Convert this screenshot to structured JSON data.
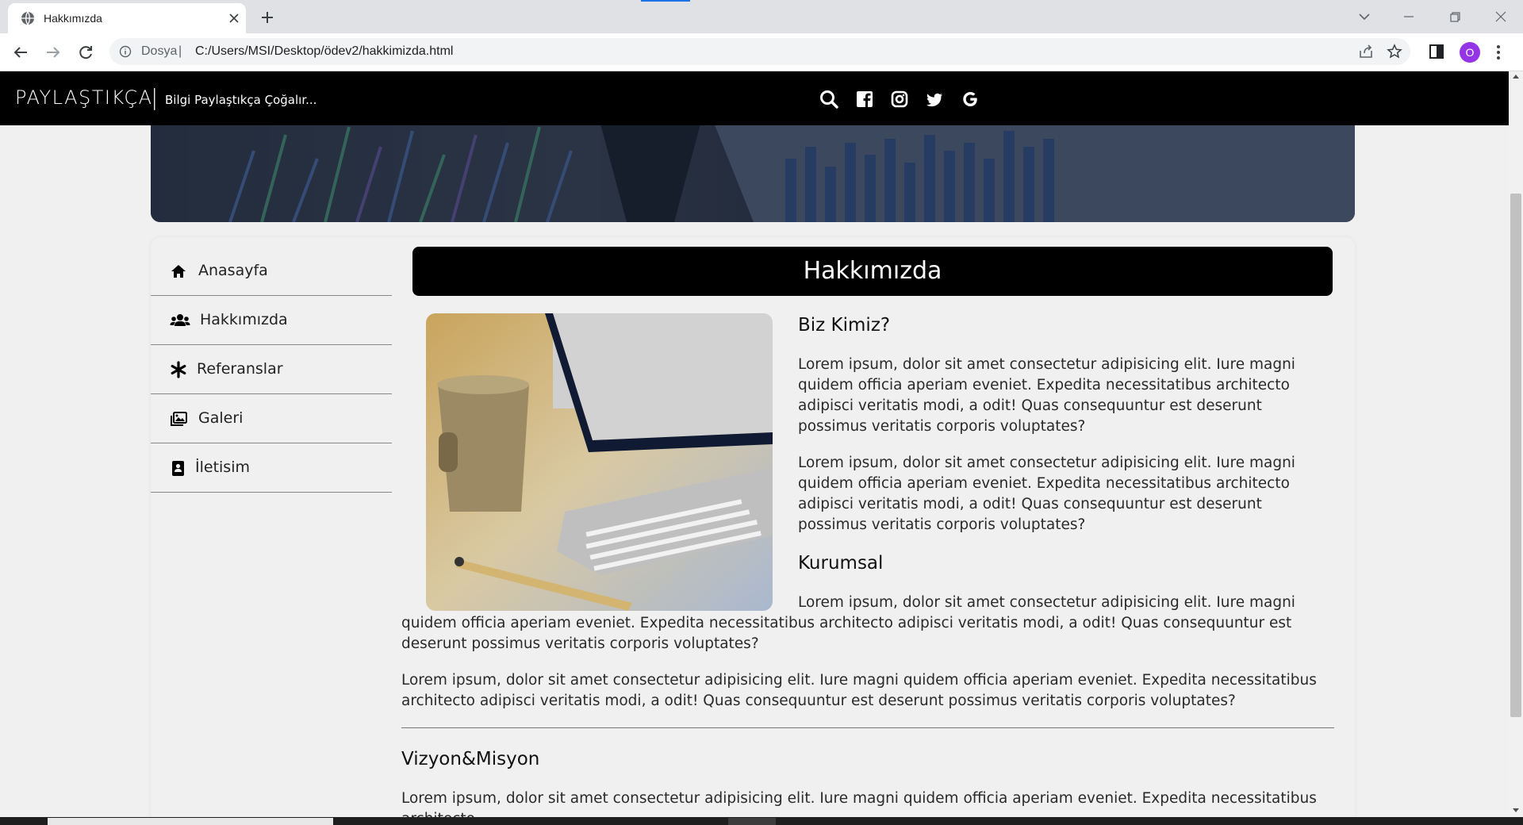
{
  "browser": {
    "tab_title": "Hakkımızda",
    "omnibox_dosya": "Dosya",
    "omnibox_separator": "|",
    "url": "C:/Users/MSI/Desktop/ödev2/hakkimizda.html",
    "profile_initial": "O",
    "profile_color": "#9334e6"
  },
  "site": {
    "brand": "PAYLAŞTIKÇA",
    "brand_separator": "|",
    "tagline": "Bilgi Paylaştıkça Çoğalır...",
    "social_icons": [
      "search-icon",
      "facebook-icon",
      "instagram-icon",
      "twitter-icon",
      "google-icon"
    ],
    "header_color": "#000000"
  },
  "sidebar": {
    "items": [
      {
        "label": "Anasayfa",
        "icon": "home-icon"
      },
      {
        "label": "Hakkımızda",
        "icon": "users-icon"
      },
      {
        "label": "Referanslar",
        "icon": "asterisk-icon"
      },
      {
        "label": "Galeri",
        "icon": "images-icon"
      },
      {
        "label": "İletisim",
        "icon": "contact-icon"
      }
    ]
  },
  "main": {
    "title": "Hakkımızda",
    "section1_heading": "Biz Kimiz?",
    "section1_p1": "Lorem ipsum, dolor sit amet consectetur adipisicing elit. Iure magni quidem officia aperiam eveniet. Expedita necessitatibus architecto adipisci veritatis modi, a odit! Quas consequuntur est deserunt possimus veritatis corporis voluptates?",
    "section1_p2": "Lorem ipsum, dolor sit amet consectetur adipisicing elit. Iure magni quidem officia aperiam eveniet. Expedita necessitatibus architecto adipisci veritatis modi, a odit! Quas consequuntur est deserunt possimus veritatis corporis voluptates?",
    "section2_heading": "Kurumsal",
    "section2_p1": "Lorem ipsum, dolor sit amet consectetur adipisicing elit. Iure magni quidem officia aperiam eveniet. Expedita necessitatibus architecto adipisci veritatis modi, a odit! Quas consequuntur est deserunt possimus veritatis corporis voluptates?",
    "section2_p2": "Lorem ipsum, dolor sit amet consectetur adipisicing elit. Iure magni quidem officia aperiam eveniet. Expedita necessitatibus architecto adipisci veritatis modi, a odit! Quas consequuntur est deserunt possimus veritatis corporis voluptates?",
    "section3_heading": "Vizyon&Misyon",
    "section3_p1": "Lorem ipsum, dolor sit amet consectetur adipisicing elit. Iure magni quidem officia aperiam eveniet. Expedita necessitatibus architecto"
  }
}
